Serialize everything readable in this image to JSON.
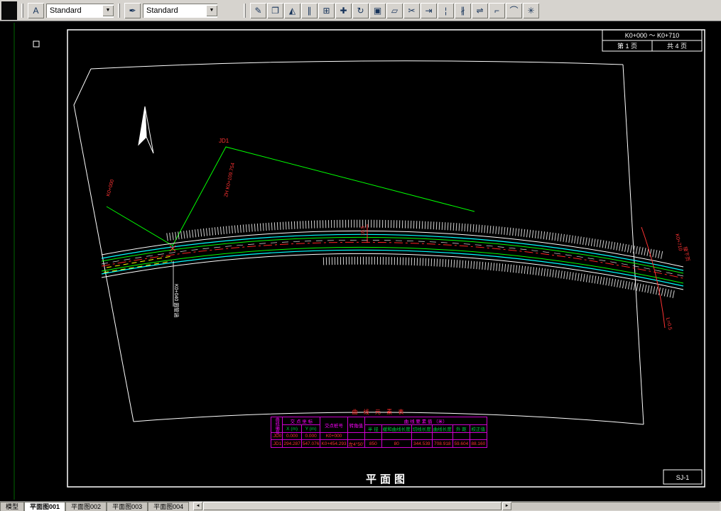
{
  "colors": {
    "chrome": "#d6d3ce",
    "canvas": "#000000",
    "frame": "#ffffff",
    "road_edge": "#ffffff",
    "road_cyan": "#00ffff",
    "road_green": "#00ff00",
    "centerline_red": "#ff2020",
    "tangent_green": "#00ff00",
    "label_red": "#ff3333",
    "table_grid": "#cf00cf",
    "yellow": "#ffff00"
  },
  "toolbar": {
    "text_style_value": "Standard",
    "dim_style_value": "Standard",
    "combo_arrow": "▼",
    "style_button_glyph": "A",
    "dimstyle_button_glyph": "✒",
    "modify_buttons": [
      {
        "name": "erase",
        "glyph": "✎"
      },
      {
        "name": "copy",
        "glyph": "❐"
      },
      {
        "name": "mirror",
        "glyph": "◭"
      },
      {
        "name": "offset",
        "glyph": "∥"
      },
      {
        "name": "array",
        "glyph": "⊞"
      },
      {
        "name": "move",
        "glyph": "✚"
      },
      {
        "name": "rotate",
        "glyph": "↻"
      },
      {
        "name": "scale",
        "glyph": "▣"
      },
      {
        "name": "stretch",
        "glyph": "▱"
      },
      {
        "name": "trim",
        "glyph": "✂"
      },
      {
        "name": "extend",
        "glyph": "⇥"
      },
      {
        "name": "break-at-point",
        "glyph": "¦"
      },
      {
        "name": "break",
        "glyph": "∦"
      },
      {
        "name": "join",
        "glyph": "⇌"
      },
      {
        "name": "chamfer",
        "glyph": "⌐"
      },
      {
        "name": "fillet",
        "glyph": "⌒"
      },
      {
        "name": "explode",
        "glyph": "✳"
      }
    ]
  },
  "drawing": {
    "header": {
      "station_range": "K0+000 ～ K0+710",
      "page_no": "第 1 页",
      "page_total": "共 4 页"
    },
    "title": "平面图",
    "sheet_no": "SJ-1",
    "jd_label": "JD1",
    "start_label": "K0+000",
    "zh_label": "ZH K0+109.754",
    "culvert_label": "K0+040 圆管涵",
    "width_dim": "16.5",
    "match_label": "K0+710",
    "match_note": "接下页",
    "slope_note": "L=0.5"
  },
  "curve_table": {
    "title": "曲 线 元 素 表",
    "corner_header": "曲线编号",
    "group_headers": [
      "交 点 坐 标",
      "交点桩号",
      "转角值",
      "曲 线 要 素 值 （米）"
    ],
    "sub_headers": [
      "X (m)",
      "Y (m)",
      "半 径",
      "缓和曲线长度",
      "切线长度",
      "曲线长度",
      "外 距",
      "校正值"
    ],
    "rows": [
      {
        "id": ".JD0",
        "values": [
          "0.000",
          "0.000",
          "K0+000",
          "",
          "",
          "",
          "",
          "",
          "",
          ""
        ]
      },
      {
        "id": ".JD1",
        "values": [
          "294.287",
          "547.076",
          "K0+454.293",
          "左4°50′",
          "850",
          "80",
          "344.539",
          "708.918",
          "59.604",
          "88.160"
        ]
      }
    ]
  },
  "layout_tabs": {
    "items": [
      "模型",
      "平面图001",
      "平面图002",
      "平面图003",
      "平面图004"
    ],
    "active": "平面图001"
  }
}
